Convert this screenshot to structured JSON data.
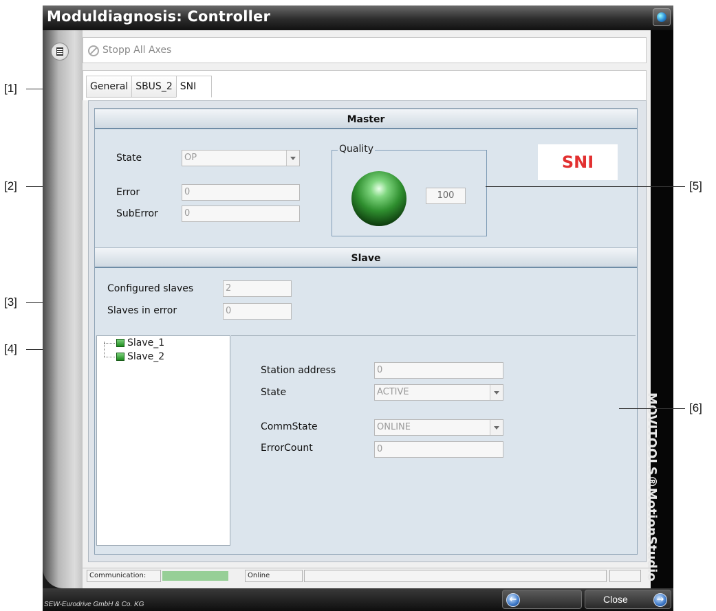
{
  "window": {
    "title": "Moduldiagnosis: Controller"
  },
  "toolbar": {
    "stop_all_label": "Stopp All Axes"
  },
  "tabs": [
    {
      "label": "General"
    },
    {
      "label": "SBUS_2"
    },
    {
      "label": "SNI"
    }
  ],
  "master": {
    "header": "Master",
    "state_label": "State",
    "state_value": "OP",
    "error_label": "Error",
    "error_value": "0",
    "suberror_label": "SubError",
    "suberror_value": "0",
    "quality_label": "Quality",
    "quality_value": "100",
    "badge": "SNI"
  },
  "slave": {
    "header": "Slave",
    "configured_label": "Configured slaves",
    "configured_value": "2",
    "in_error_label": "Slaves in error",
    "in_error_value": "0",
    "tree": [
      {
        "label": "Slave_1"
      },
      {
        "label": "Slave_2"
      }
    ],
    "detail": {
      "station_address_label": "Station address",
      "station_address_value": "0",
      "state_label": "State",
      "state_value": "ACTIVE",
      "commstate_label": "CommState",
      "commstate_value": "ONLINE",
      "errorcount_label": "ErrorCount",
      "errorcount_value": "0"
    }
  },
  "statusbar": {
    "communication_label": "Communication:",
    "online_label": "Online"
  },
  "brand_vertical": "MOVITOOLS®MotionStudio",
  "footer": {
    "copyright": "SEW-Eurodrive GmbH & Co. KG",
    "close_label": "Close"
  },
  "callouts": [
    "[1]",
    "[2]",
    "[3]",
    "[4]",
    "[5]",
    "[6]"
  ],
  "icons": {
    "globe": "globe-icon",
    "rail": "list-view-icon",
    "stop": "stop-icon",
    "back": "arrow-left-icon",
    "forward": "arrow-right-icon"
  }
}
